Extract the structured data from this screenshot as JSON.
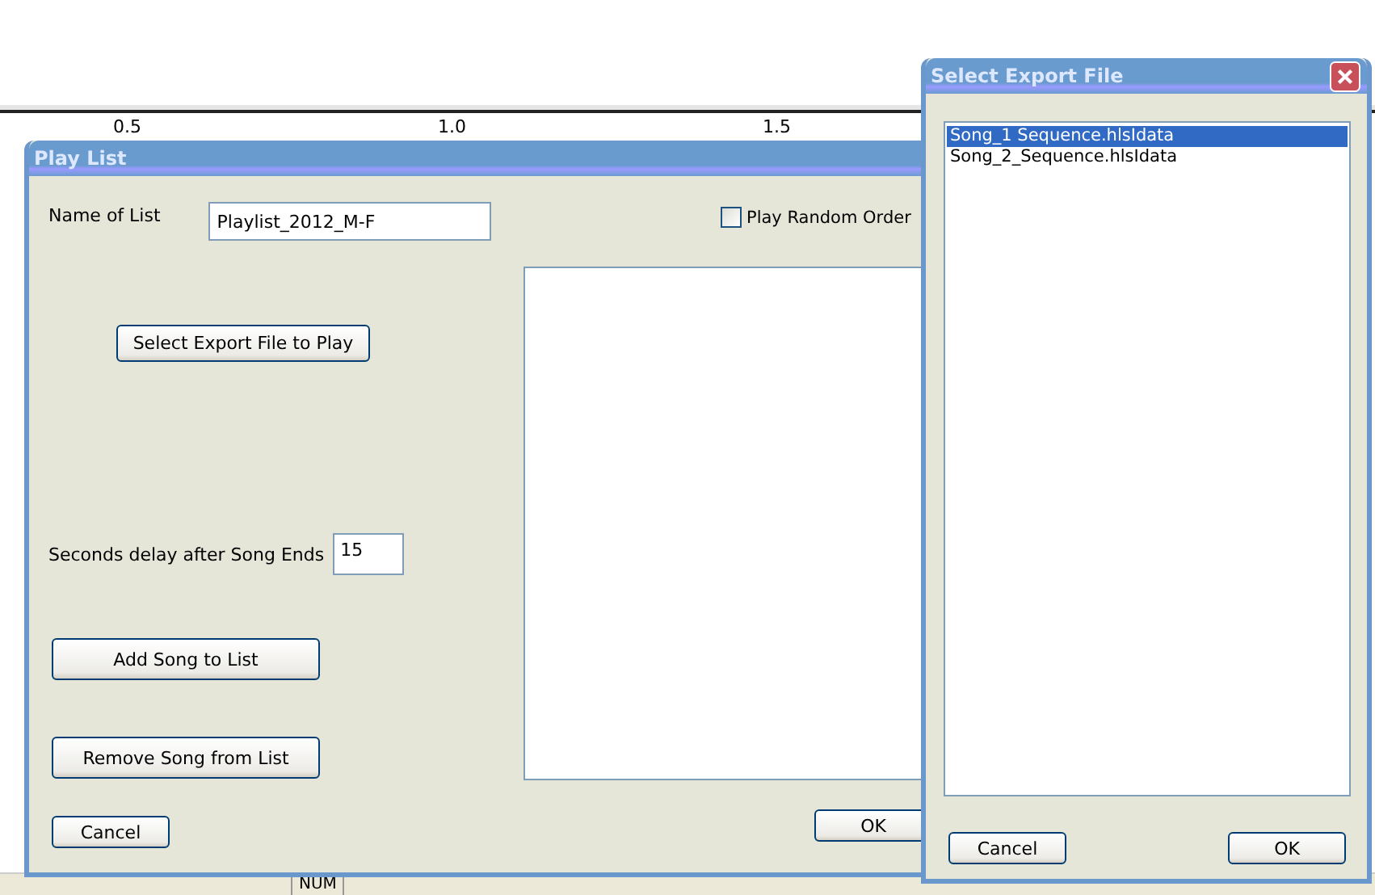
{
  "ruler": {
    "ticks": [
      "0.5",
      "1.0",
      "1.5"
    ]
  },
  "play_list": {
    "title": "Play List",
    "name_label": "Name of List",
    "name_value": "Playlist_2012_M-F",
    "random_order": {
      "label": "Play Random Order",
      "checked": false
    },
    "select_button": "Select Export File to Play",
    "delay_label": "Seconds delay after Song Ends",
    "delay_value": "15",
    "add_button": "Add Song to List",
    "remove_button": "Remove Song from List",
    "cancel": "Cancel",
    "ok": "OK"
  },
  "select_export": {
    "title": "Select Export File",
    "files": [
      {
        "name": "Song_1 Sequence.hlsIdata",
        "selected": true
      },
      {
        "name": "Song_2_Sequence.hlsIdata",
        "selected": false
      }
    ],
    "cancel": "Cancel",
    "ok": "OK"
  },
  "status_bar": {
    "num": "NUM"
  }
}
